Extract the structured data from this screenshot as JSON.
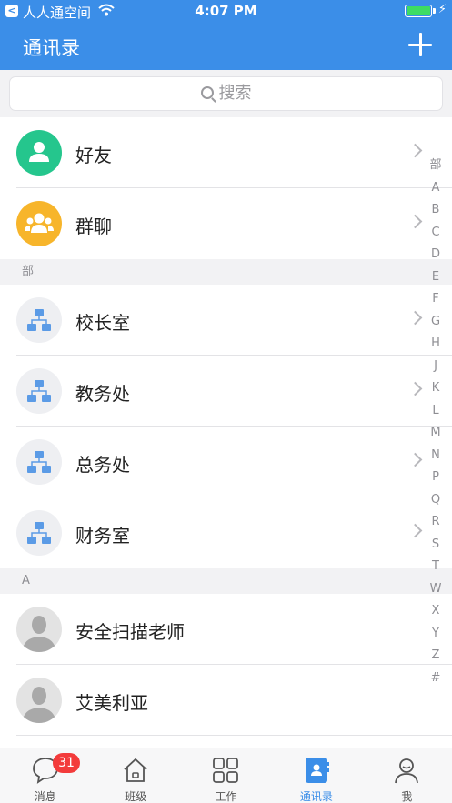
{
  "status": {
    "carrier": "人人通空间",
    "time": "4:07 PM"
  },
  "header": {
    "title": "通讯录"
  },
  "search": {
    "placeholder": "搜索"
  },
  "top_items": [
    {
      "name": "好友",
      "icon": "friends-icon"
    },
    {
      "name": "群聊",
      "icon": "group-chat-icon"
    }
  ],
  "sections": {
    "dept": "部",
    "a": "A"
  },
  "departments": [
    "校长室",
    "教务处",
    "总务处",
    "财务室"
  ],
  "contacts_a": [
    "安全扫描老师",
    "艾美利亚"
  ],
  "index_letters": [
    "部",
    "A",
    "B",
    "C",
    "D",
    "E",
    "F",
    "G",
    "H",
    "J",
    "K",
    "L",
    "M",
    "N",
    "P",
    "Q",
    "R",
    "S",
    "T",
    "W",
    "X",
    "Y",
    "Z",
    "#"
  ],
  "tabs": [
    {
      "label": "消息",
      "badge": "31"
    },
    {
      "label": "班级"
    },
    {
      "label": "工作"
    },
    {
      "label": "通讯录"
    },
    {
      "label": "我"
    }
  ],
  "colors": {
    "accent": "#3b8ee8",
    "green": "#25c68d",
    "yellow": "#f7b52b",
    "badge": "#f33b3b"
  }
}
